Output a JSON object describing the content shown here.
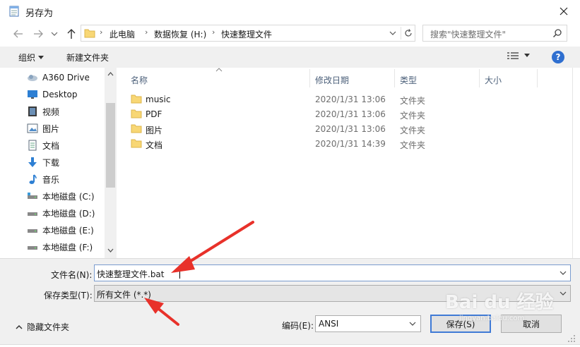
{
  "window": {
    "title": "另存为"
  },
  "nav": {
    "breadcrumbs": [
      "此电脑",
      "数据恢复 (H:)",
      "快速整理文件"
    ],
    "search_placeholder": "搜索\"快速整理文件\""
  },
  "toolbar": {
    "organize": "组织",
    "new_folder": "新建文件夹",
    "help": "?"
  },
  "sidebar": {
    "items": [
      {
        "label": "A360 Drive",
        "icon": "cloud-icon"
      },
      {
        "label": "Desktop",
        "icon": "desktop-icon"
      },
      {
        "label": "视频",
        "icon": "video-icon"
      },
      {
        "label": "图片",
        "icon": "pictures-icon"
      },
      {
        "label": "文档",
        "icon": "documents-icon"
      },
      {
        "label": "下载",
        "icon": "download-icon"
      },
      {
        "label": "音乐",
        "icon": "music-icon"
      },
      {
        "label": "本地磁盘 (C:)",
        "icon": "drive-icon"
      },
      {
        "label": "本地磁盘 (D:)",
        "icon": "drive-icon"
      },
      {
        "label": "本地磁盘 (E:)",
        "icon": "drive-icon"
      },
      {
        "label": "本地磁盘 (F:)",
        "icon": "drive-icon"
      }
    ]
  },
  "filelist": {
    "columns": {
      "name": "名称",
      "modified": "修改日期",
      "type": "类型",
      "size": "大小"
    },
    "rows": [
      {
        "name": "music",
        "modified": "2020/1/31 13:06",
        "type": "文件夹"
      },
      {
        "name": "PDF",
        "modified": "2020/1/31 13:06",
        "type": "文件夹"
      },
      {
        "name": "图片",
        "modified": "2020/1/31 13:06",
        "type": "文件夹"
      },
      {
        "name": "文档",
        "modified": "2020/1/31 14:39",
        "type": "文件夹"
      }
    ]
  },
  "form": {
    "filename_label": "文件名(N):",
    "filename_value": "快速整理文件.bat",
    "filetype_label": "保存类型(T):",
    "filetype_value": "所有文件  (*.*)",
    "encoding_label": "编码(E):",
    "encoding_value": "ANSI",
    "hide_folders": "隐藏文件夹",
    "save": "保存(S)",
    "cancel": "取消"
  },
  "watermark": {
    "text": "Bai du 经验",
    "sub": "jingyan.baidu.com"
  },
  "colors": {
    "accent": "#3f7ad6",
    "folder": "#f8d775",
    "arrow": "#e8312a",
    "help": "#2f6fd0"
  }
}
